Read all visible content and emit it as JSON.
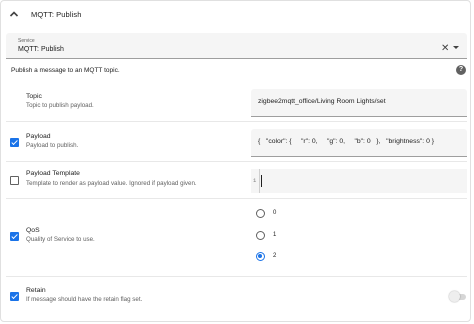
{
  "header": {
    "title": "MQTT: Publish"
  },
  "service": {
    "label": "Service",
    "value": "MQTT: Publish"
  },
  "description": "Publish a message to an MQTT topic.",
  "help_icon": "?",
  "fields": {
    "topic": {
      "name": "Topic",
      "description": "Topic to publish payload.",
      "value": "zigbee2mqtt_office/Living Room Lights/set"
    },
    "payload": {
      "name": "Payload",
      "description": "Payload to publish.",
      "enabled": true,
      "value": "{   \"color\": {     \"r\": 0,     \"g\": 0,     \"b\": 0   },   \"brightness\": 0 }"
    },
    "payload_template": {
      "name": "Payload Template",
      "description": "Template to render as payload value. Ignored if payload given.",
      "enabled": false,
      "line_number": "1"
    },
    "qos": {
      "name": "QoS",
      "description": "Quality of Service to use.",
      "enabled": true,
      "options": [
        "0",
        "1",
        "2"
      ],
      "selected": "2"
    },
    "retain": {
      "name": "Retain",
      "description": "If message should have the retain flag set.",
      "enabled": true,
      "toggle_on": false
    }
  },
  "colors": {
    "accent": "#1a73e8",
    "field_bg": "#f5f5f5"
  }
}
